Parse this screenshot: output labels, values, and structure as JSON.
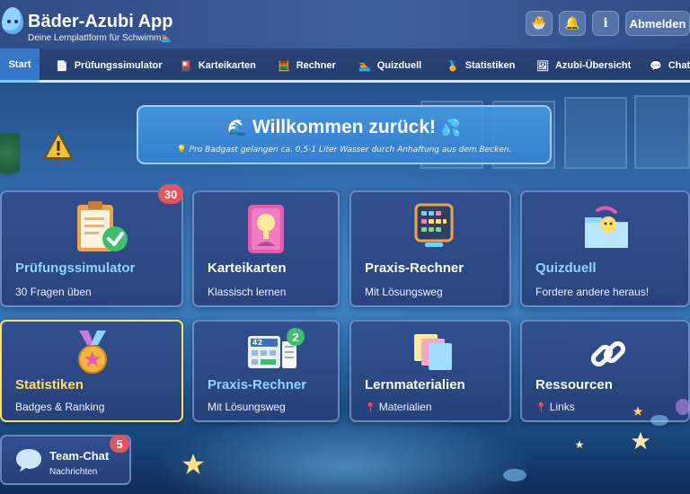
{
  "header": {
    "title": "Bäder-Azubi App",
    "subtitle": "Deine Lernplattform für Schwimm",
    "logout_label": "Abmelden",
    "actions": [
      {
        "name": "mascot-icon",
        "glyph": "🐣"
      },
      {
        "name": "bell-icon",
        "glyph": "🔔"
      },
      {
        "name": "info-icon",
        "glyph": "ℹ"
      }
    ]
  },
  "nav": {
    "tabs": [
      {
        "label": "Start",
        "icon": "",
        "icon_name": "none",
        "active": true
      },
      {
        "label": "Prüfungssimulator",
        "icon": "📄",
        "icon_name": "document-icon",
        "active": false
      },
      {
        "label": "Karteikarten",
        "icon": "🎴",
        "icon_name": "cards-icon",
        "active": false
      },
      {
        "label": "Rechner",
        "icon": "🧮",
        "icon_name": "calculator-icon",
        "active": false
      },
      {
        "label": "Quizduell",
        "icon": "🏊",
        "icon_name": "swimmer-icon",
        "active": false
      },
      {
        "label": "Statistiken",
        "icon": "🏅",
        "icon_name": "medal-icon",
        "active": false
      },
      {
        "label": "Azubi-Übersicht",
        "icon": "🖼",
        "icon_name": "overview-icon",
        "active": false
      },
      {
        "label": "Chat",
        "icon": "💬",
        "icon_name": "chat-icon",
        "active": false
      }
    ]
  },
  "welcome": {
    "title": "Willkommen zurück!",
    "fact": "Pro Badgast gelangen ca. 0,5-1 Liter Wasser durch Anhaftung aus dem Becken."
  },
  "cards": [
    {
      "title": "Prüfungssimulator",
      "subtitle": "30 Fragen üben",
      "badge": "30",
      "title_color": "#8fd6ff",
      "icon_name": "clipboard-check-icon"
    },
    {
      "title": "Karteikarten",
      "subtitle": "Klassisch lernen",
      "badge": "",
      "title_color": "#ffffff",
      "icon_name": "flashcard-icon"
    },
    {
      "title": "Praxis-Rechner",
      "subtitle": "Mit Lösungsweg",
      "badge": "",
      "title_color": "#ffffff",
      "icon_name": "abacus-icon"
    },
    {
      "title": "Quizduell",
      "subtitle": "Fordere andere heraus!",
      "badge": "",
      "title_color": "#8fd6ff",
      "icon_name": "quiz-folder-icon"
    },
    {
      "title": "Statistiken",
      "subtitle": "Badges & Ranking",
      "badge": "",
      "title_color": "#ffe066",
      "icon_name": "medal-icon"
    },
    {
      "title": "Praxis-Rechner",
      "subtitle": "Mit Lösungsweg",
      "badge": "2",
      "title_color": "#8fd6ff",
      "icon_name": "calculator-icon"
    },
    {
      "title": "Lernmaterialien",
      "subtitle": "Materialien",
      "badge": "",
      "title_color": "#ffffff",
      "icon_name": "paper-stack-icon"
    },
    {
      "title": "Ressourcen",
      "subtitle": "Links",
      "badge": "",
      "title_color": "#ffffff",
      "icon_name": "link-icon"
    }
  ],
  "calc_display": "42",
  "chat": {
    "title": "Team-Chat",
    "subtitle": "Nachrichten",
    "badge": "5"
  },
  "colors": {
    "accent": "#3577c9",
    "badge": "#e2555e",
    "badge_green": "#3fbf6e",
    "highlight_title": "#8fd6ff",
    "gold_title": "#ffe066"
  }
}
